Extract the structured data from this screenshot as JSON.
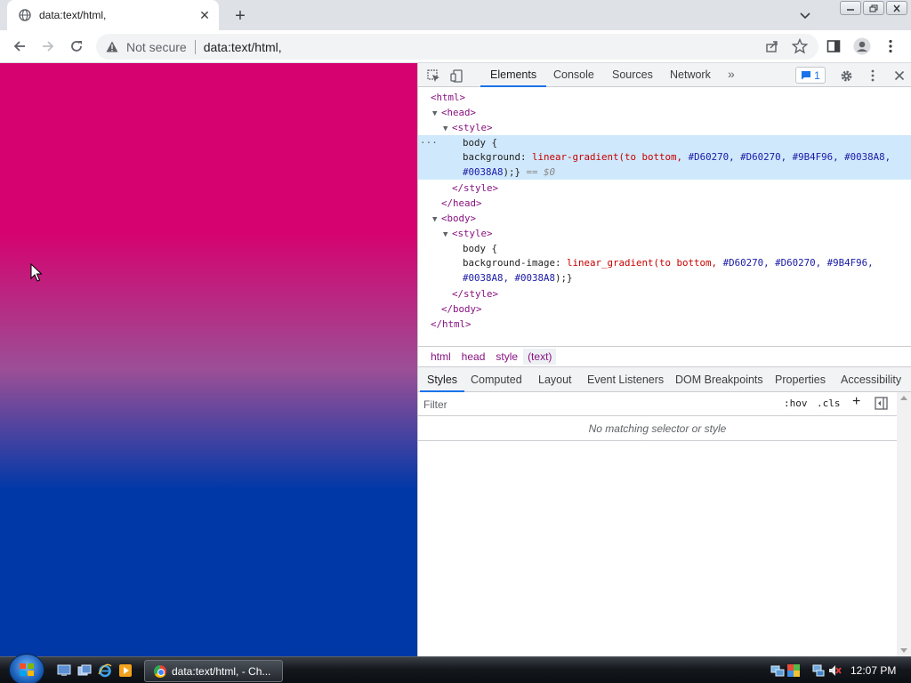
{
  "browser": {
    "tab": {
      "title": "data:text/html,"
    },
    "omnibox": {
      "security_label": "Not secure",
      "url": "data:text/html,"
    }
  },
  "page": {
    "gradient_colors": [
      "#D60270",
      "#D60270",
      "#9B4F96",
      "#0038A8",
      "#0038A8"
    ]
  },
  "devtools": {
    "tabs": [
      "Elements",
      "Console",
      "Sources",
      "Network"
    ],
    "active_tab": "Elements",
    "issues_count": "1",
    "dom": {
      "html_open": "<html>",
      "head_open": "<head>",
      "style_open": "<style>",
      "body_sel": "body {",
      "bg_prop": "background:",
      "bg_fn": "linear-gradient(to bottom,",
      "bg_v1": "#D60270,",
      "bg_v2": "#D60270,",
      "bg_v3": "#9B4F96,",
      "bg_v4": "#0038A8,",
      "bg_v5": "#0038A8",
      "bg_close": ");}",
      "eq_dollar": "== $0",
      "style_close": "</style>",
      "head_close": "</head>",
      "body_open": "<body>",
      "style2_open": "<style>",
      "body2_sel": "body {",
      "bgi_prop": "background-image:",
      "bgi_fn": "linear_gradient(to bottom,",
      "bgi_v1": "#D60270,",
      "bgi_v2": "#D60270,",
      "bgi_v3": "#9B4F96,",
      "bgi_v4": "#0038A8,",
      "bgi_v5": "#0038A8",
      "bgi_close": ");}",
      "style2_close": "</style>",
      "body_close": "</body>",
      "html_close": "</html>"
    },
    "breadcrumbs": [
      "html",
      "head",
      "style",
      "(text)"
    ],
    "sub_tabs": [
      "Styles",
      "Computed",
      "Layout",
      "Event Listeners",
      "DOM Breakpoints",
      "Properties",
      "Accessibility"
    ],
    "active_sub_tab": "Styles",
    "filter": {
      "placeholder": "Filter",
      "hov": ":hov",
      "cls": ".cls",
      "add": "+"
    },
    "empty_message": "No matching selector or style"
  },
  "taskbar": {
    "task_label": "data:text/html, - Ch...",
    "clock": "12:07 PM"
  }
}
